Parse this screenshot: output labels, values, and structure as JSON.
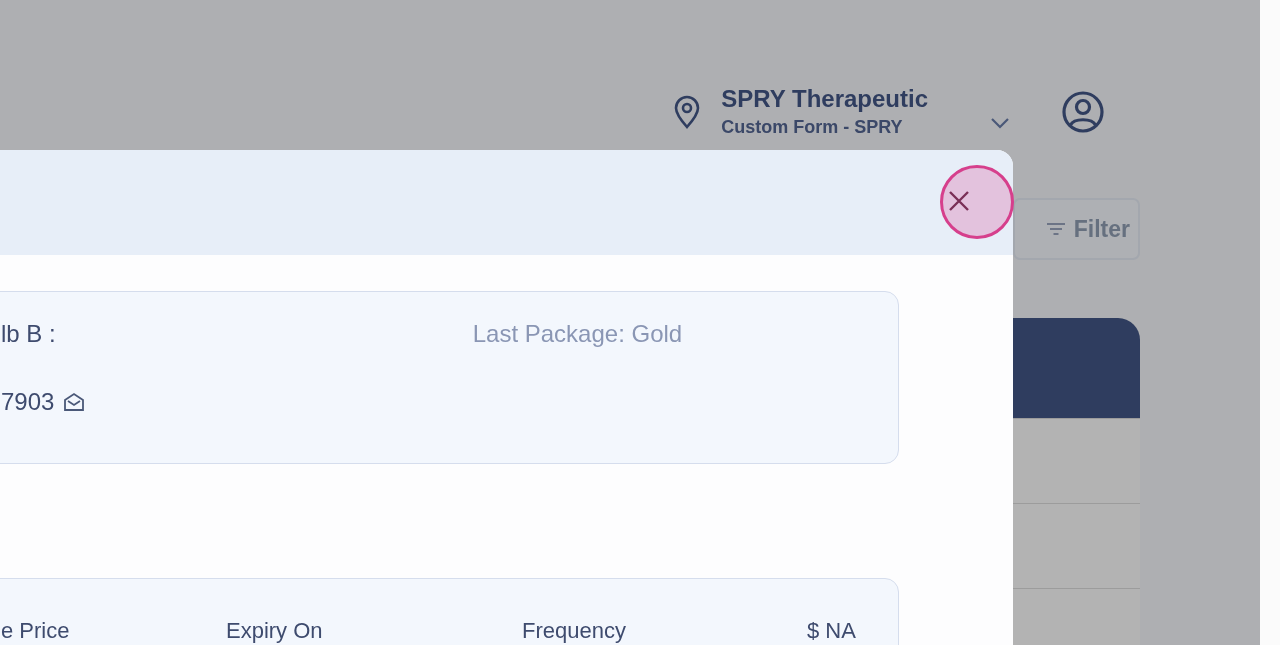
{
  "header": {
    "location_name": "SPRY Therapeutic",
    "form_name": "Custom Form - SPRY"
  },
  "filter_button": {
    "label": "Filter"
  },
  "modal": {
    "cards": [
      {
        "kind": "contact",
        "title": "lb B :",
        "last_package": "Last Package: Gold",
        "phone": "7903"
      },
      {
        "kind": "plan",
        "columns": [
          "e Price",
          "Expiry On",
          "Frequency",
          "$ NA"
        ]
      }
    ]
  }
}
